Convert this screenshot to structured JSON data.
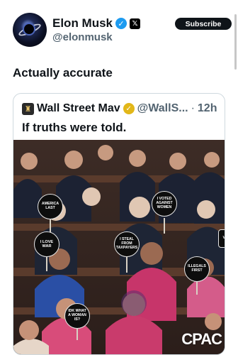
{
  "author": {
    "name": "Elon Musk",
    "handle": "@elonmusk",
    "verified_icon": "verified-badge-icon",
    "affiliation_icon": "x-logo-icon"
  },
  "actions": {
    "subscribe_label": "Subscribe"
  },
  "tweet": {
    "text": "Actually accurate"
  },
  "quoted": {
    "name": "Wall Street Mav",
    "handle": "@WallS...",
    "separator": "·",
    "time": "12h",
    "text": "If truths were told.",
    "verified_icon": "gold-verified-badge-icon",
    "media": {
      "signs": [
        "AMERICA LAST",
        "I VOTED AGAINST WOMEN",
        "I LOVE WAR",
        "I STEAL FROM TAXPAYERS",
        "ILLEGALS FIRST",
        "IDK WHAT A WOMAN IS?"
      ],
      "watermark": "CPAC",
      "edge_text": "VE"
    }
  },
  "colors": {
    "accent": "#1d9bf0",
    "gold_badge": "#e2b719",
    "text_secondary": "#536471"
  }
}
